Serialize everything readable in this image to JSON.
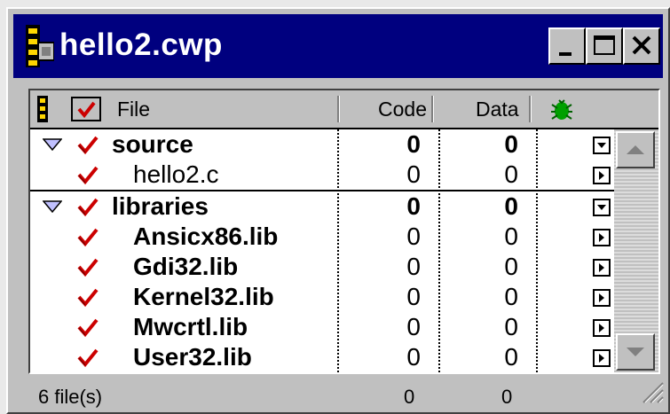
{
  "window": {
    "title": "hello2.cwp"
  },
  "header": {
    "file_label": "File",
    "code_label": "Code",
    "data_label": "Data"
  },
  "rows": [
    {
      "name": "source",
      "type": "group",
      "code": "0",
      "data": "0",
      "expanded": true
    },
    {
      "name": "hello2.c",
      "type": "file",
      "code": "0",
      "data": "0"
    },
    {
      "name": "libraries",
      "type": "group",
      "code": "0",
      "data": "0",
      "expanded": true
    },
    {
      "name": "Ansicx86.lib",
      "type": "file",
      "code": "0",
      "data": "0"
    },
    {
      "name": "Gdi32.lib",
      "type": "file",
      "code": "0",
      "data": "0"
    },
    {
      "name": "Kernel32.lib",
      "type": "file",
      "code": "0",
      "data": "0"
    },
    {
      "name": "Mwcrtl.lib",
      "type": "file",
      "code": "0",
      "data": "0"
    },
    {
      "name": "User32.lib",
      "type": "file",
      "code": "0",
      "data": "0"
    }
  ],
  "status": {
    "file_count": "6 file(s)",
    "code_total": "0",
    "data_total": "0"
  },
  "colors": {
    "title_bar": "#00007f",
    "checkmark": "#cc0000",
    "tree_triangle": "#8080ff",
    "bug_icon": "#00a000"
  },
  "icons": [
    "project-doc-icon",
    "minimize-icon",
    "maximize-icon",
    "close-icon",
    "link-order-icon",
    "checkmark-header-icon",
    "debug-bug-icon",
    "disclosure-triangle-icon",
    "checkmark-icon",
    "popup-menu-icon",
    "scroll-up-icon",
    "scroll-down-icon",
    "resize-grip-icon"
  ]
}
